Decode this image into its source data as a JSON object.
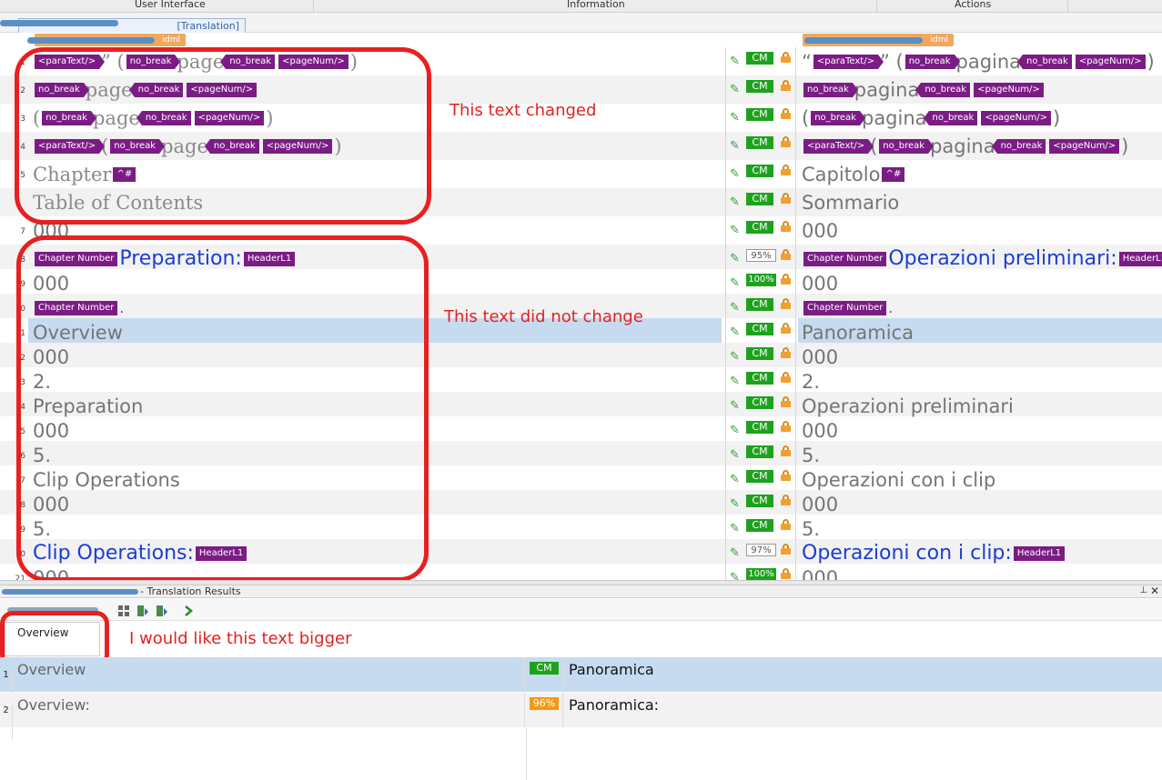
{
  "columns": {
    "ui": "User Interface",
    "info": "Information",
    "actions": "Actions"
  },
  "tab": {
    "label": "[Translation]"
  },
  "source_file": "idml",
  "target_file": "idml",
  "rows": [
    {
      "num": "1",
      "status": "CM",
      "src": [
        {
          "t": "tag",
          "v": "<paraText/>",
          "k": "open"
        },
        {
          "t": "text",
          "v": "” ("
        },
        {
          "t": "tag",
          "v": "no_break",
          "k": "open"
        },
        {
          "t": "text",
          "v": "page"
        },
        {
          "t": "tag",
          "v": "no_break",
          "k": "close"
        },
        {
          "t": "tag",
          "v": "<pageNum/>",
          "k": "plain"
        },
        {
          "t": "text",
          "v": ")"
        }
      ],
      "tgt": [
        {
          "t": "text",
          "v": "“"
        },
        {
          "t": "tag",
          "v": "<paraText/>",
          "k": "open"
        },
        {
          "t": "text",
          "v": "” ("
        },
        {
          "t": "tag",
          "v": "no_break",
          "k": "open"
        },
        {
          "t": "text",
          "v": "pagina"
        },
        {
          "t": "tag",
          "v": "no_break",
          "k": "close"
        },
        {
          "t": "tag",
          "v": "<pageNum/>",
          "k": "plain"
        },
        {
          "t": "text",
          "v": ")"
        }
      ]
    },
    {
      "num": "2",
      "status": "CM",
      "src": [
        {
          "t": "tag",
          "v": "no_break",
          "k": "open"
        },
        {
          "t": "text",
          "v": "page"
        },
        {
          "t": "tag",
          "v": "no_break",
          "k": "close"
        },
        {
          "t": "tag",
          "v": "<pageNum/>",
          "k": "plain"
        }
      ],
      "tgt": [
        {
          "t": "tag",
          "v": "no_break",
          "k": "open"
        },
        {
          "t": "text",
          "v": "pagina"
        },
        {
          "t": "tag",
          "v": "no_break",
          "k": "close"
        },
        {
          "t": "tag",
          "v": "<pageNum/>",
          "k": "plain"
        }
      ]
    },
    {
      "num": "3",
      "status": "CM",
      "src": [
        {
          "t": "text",
          "v": "("
        },
        {
          "t": "tag",
          "v": "no_break",
          "k": "open"
        },
        {
          "t": "text",
          "v": "page"
        },
        {
          "t": "tag",
          "v": "no_break",
          "k": "close"
        },
        {
          "t": "tag",
          "v": "<pageNum/>",
          "k": "plain"
        },
        {
          "t": "text",
          "v": ")"
        }
      ],
      "tgt": [
        {
          "t": "text",
          "v": "("
        },
        {
          "t": "tag",
          "v": "no_break",
          "k": "open"
        },
        {
          "t": "text",
          "v": "pagina"
        },
        {
          "t": "tag",
          "v": "no_break",
          "k": "close"
        },
        {
          "t": "tag",
          "v": "<pageNum/>",
          "k": "plain"
        },
        {
          "t": "text",
          "v": ")"
        }
      ]
    },
    {
      "num": "4",
      "status": "CM",
      "src": [
        {
          "t": "tag",
          "v": "<paraText/>",
          "k": "open"
        },
        {
          "t": "text",
          "v": "("
        },
        {
          "t": "tag",
          "v": "no_break",
          "k": "open"
        },
        {
          "t": "text",
          "v": "page"
        },
        {
          "t": "tag",
          "v": "no_break",
          "k": "close"
        },
        {
          "t": "tag",
          "v": "<pageNum/>",
          "k": "plain"
        },
        {
          "t": "text",
          "v": ")"
        }
      ],
      "tgt": [
        {
          "t": "tag",
          "v": "<paraText/>",
          "k": "open"
        },
        {
          "t": "text",
          "v": "("
        },
        {
          "t": "tag",
          "v": "no_break",
          "k": "open"
        },
        {
          "t": "text",
          "v": "pagina"
        },
        {
          "t": "tag",
          "v": "no_break",
          "k": "close"
        },
        {
          "t": "tag",
          "v": "<pageNum/>",
          "k": "plain"
        },
        {
          "t": "text",
          "v": ")"
        }
      ]
    },
    {
      "num": "5",
      "status": "CM",
      "src": [
        {
          "t": "text",
          "v": "Chapter"
        },
        {
          "t": "tag",
          "v": "^#",
          "k": "plain"
        }
      ],
      "tgt": [
        {
          "t": "text",
          "v": "Capitolo"
        },
        {
          "t": "tag",
          "v": "^#",
          "k": "plain"
        }
      ]
    },
    {
      "num": "",
      "status": "CM",
      "src": [
        {
          "t": "text",
          "v": "Table of Contents"
        }
      ],
      "tgt": [
        {
          "t": "text",
          "v": "Sommario"
        }
      ]
    },
    {
      "num": "7",
      "status": "CM",
      "src": [
        {
          "t": "text",
          "v": "000"
        }
      ],
      "tgt": [
        {
          "t": "text",
          "v": "000"
        }
      ]
    },
    {
      "num": "8",
      "status": "95%",
      "src": [
        {
          "t": "tag",
          "v": "Chapter Number",
          "k": "plain"
        },
        {
          "t": "hd",
          "v": "Preparation:"
        },
        {
          "t": "tag",
          "v": "HeaderL1",
          "k": "plain"
        }
      ],
      "tgt": [
        {
          "t": "tag",
          "v": "Chapter Number",
          "k": "plain"
        },
        {
          "t": "hd",
          "v": "Operazioni preliminari:"
        },
        {
          "t": "tag",
          "v": "HeaderL1",
          "k": "plain"
        }
      ]
    },
    {
      "num": "9",
      "status": "100%",
      "src": [
        {
          "t": "text",
          "v": "000"
        }
      ],
      "tgt": [
        {
          "t": "text",
          "v": "000"
        }
      ]
    },
    {
      "num": "0",
      "status": "CM",
      "src": [
        {
          "t": "tag",
          "v": "Chapter Number",
          "k": "plain"
        },
        {
          "t": "sm",
          "v": "."
        }
      ],
      "tgt": [
        {
          "t": "tag",
          "v": "Chapter Number",
          "k": "plain"
        },
        {
          "t": "sm",
          "v": "."
        }
      ]
    },
    {
      "num": "1",
      "status": "CM",
      "src": [
        {
          "t": "text",
          "v": "Overview"
        }
      ],
      "tgt": [
        {
          "t": "text",
          "v": "Panoramica"
        }
      ]
    },
    {
      "num": "2",
      "status": "CM",
      "src": [
        {
          "t": "text",
          "v": "000"
        }
      ],
      "tgt": [
        {
          "t": "text",
          "v": "000"
        }
      ]
    },
    {
      "num": "3",
      "status": "CM",
      "src": [
        {
          "t": "text",
          "v": "2."
        }
      ],
      "tgt": [
        {
          "t": "text",
          "v": "2."
        }
      ]
    },
    {
      "num": "4",
      "status": "CM",
      "src": [
        {
          "t": "text",
          "v": "Preparation"
        }
      ],
      "tgt": [
        {
          "t": "text",
          "v": "Operazioni preliminari"
        }
      ]
    },
    {
      "num": "5",
      "status": "CM",
      "src": [
        {
          "t": "text",
          "v": "000"
        }
      ],
      "tgt": [
        {
          "t": "text",
          "v": "000"
        }
      ]
    },
    {
      "num": "6",
      "status": "CM",
      "src": [
        {
          "t": "text",
          "v": "5."
        }
      ],
      "tgt": [
        {
          "t": "text",
          "v": "5."
        }
      ]
    },
    {
      "num": "7",
      "status": "CM",
      "src": [
        {
          "t": "text",
          "v": "Clip Operations"
        }
      ],
      "tgt": [
        {
          "t": "text",
          "v": "Operazioni con i clip"
        }
      ]
    },
    {
      "num": "8",
      "status": "CM",
      "src": [
        {
          "t": "text",
          "v": "000"
        }
      ],
      "tgt": [
        {
          "t": "text",
          "v": "000"
        }
      ]
    },
    {
      "num": "9",
      "status": "CM",
      "src": [
        {
          "t": "text",
          "v": "5."
        }
      ],
      "tgt": [
        {
          "t": "text",
          "v": "5."
        }
      ]
    },
    {
      "num": "0",
      "status": "97%",
      "src": [
        {
          "t": "hd",
          "v": "Clip Operations:"
        },
        {
          "t": "tag",
          "v": "HeaderL1",
          "k": "plain"
        }
      ],
      "tgt": [
        {
          "t": "hd",
          "v": "Operazioni con i clip:"
        },
        {
          "t": "tag",
          "v": "HeaderL1",
          "k": "plain"
        }
      ]
    },
    {
      "num": "21",
      "status": "100%",
      "src": [
        {
          "t": "text",
          "v": "000"
        }
      ],
      "tgt": [
        {
          "t": "text",
          "v": "000"
        }
      ]
    }
  ],
  "annotations": {
    "changed": "This text changed",
    "not_changed": "This text did not change",
    "bigger": "I would like this text bigger"
  },
  "results_panel": {
    "title": "- Translation Results",
    "tab_label": "Overview",
    "results": [
      {
        "num": "1",
        "source": "Overview",
        "badge": "CM",
        "badge_color": "#1ea21e",
        "target": "Panoramica"
      },
      {
        "num": "2",
        "source": "Overview:",
        "badge": "96%",
        "badge_color": "#f39a12",
        "target": "Panoramica:"
      }
    ]
  },
  "colors": {
    "accent_tag": "#7b1c85",
    "status_green": "#1ea21e",
    "annotation_red": "#e8201f",
    "heading_blue": "#1b3ed1",
    "fuzzy_orange": "#f39a12"
  }
}
